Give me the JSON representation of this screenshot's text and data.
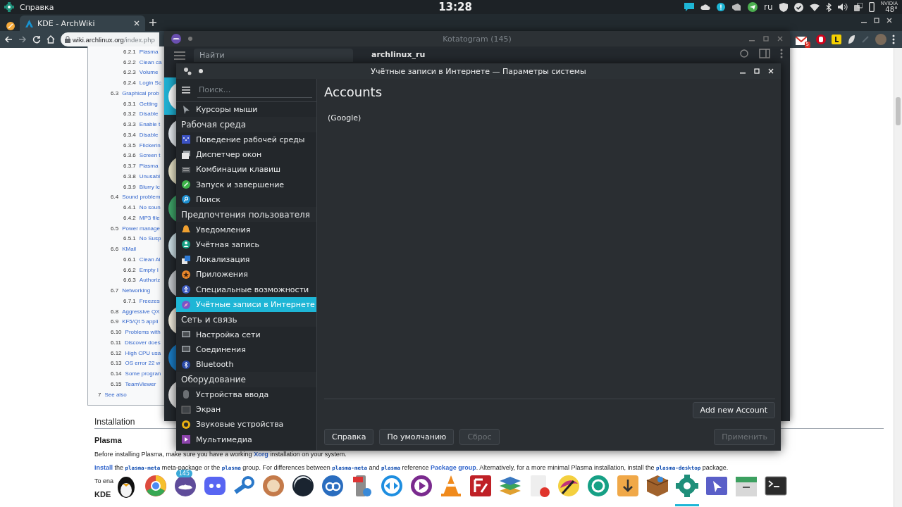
{
  "top_panel": {
    "app_title": "Справка",
    "clock": "13:28",
    "keyboard_layout": "ru",
    "gpu_label": "NVIDIA",
    "gpu_temp": "48°"
  },
  "browser": {
    "tab": {
      "title": "KDE - ArchWiki",
      "selected": true
    },
    "url_host": "wiki.archlinux.org",
    "url_path": "/index.php",
    "mail_badge": "5"
  },
  "wiki": {
    "toc": [
      {
        "children": [
          {
            "children": [
              {
                "number": "6.2.1",
                "title": "Plasma"
              },
              {
                "number": "6.2.2",
                "title": "Clean ca"
              },
              {
                "number": "6.2.3",
                "title": "Volume"
              },
              {
                "number": "6.2.4",
                "title": "Login Sc"
              }
            ]
          },
          {
            "number": "6.3",
            "title": "Graphical prob",
            "children": [
              {
                "number": "6.3.1",
                "title": "Getting"
              },
              {
                "number": "6.3.2",
                "title": "Disable"
              },
              {
                "number": "6.3.3",
                "title": "Enable t"
              },
              {
                "number": "6.3.4",
                "title": "Disable"
              },
              {
                "number": "6.3.5",
                "title": "Flickerin"
              },
              {
                "number": "6.3.6",
                "title": "Screen t"
              },
              {
                "number": "6.3.7",
                "title": "Plasma"
              },
              {
                "number": "6.3.8",
                "title": "Unusabl"
              },
              {
                "number": "6.3.9",
                "title": "Blurry ic"
              }
            ]
          },
          {
            "number": "6.4",
            "title": "Sound problem",
            "children": [
              {
                "number": "6.4.1",
                "title": "No soun"
              },
              {
                "number": "6.4.2",
                "title": "MP3 file"
              }
            ]
          },
          {
            "number": "6.5",
            "title": "Power manage",
            "children": [
              {
                "number": "6.5.1",
                "title": "No Susp"
              }
            ]
          },
          {
            "number": "6.6",
            "title": "KMail",
            "children": [
              {
                "number": "6.6.1",
                "title": "Clean Al"
              },
              {
                "number": "6.6.2",
                "title": "Empty I"
              },
              {
                "number": "6.6.3",
                "title": "Authoriz"
              }
            ]
          },
          {
            "number": "6.7",
            "title": "Networking",
            "children": [
              {
                "number": "6.7.1",
                "title": "Freezes"
              }
            ]
          },
          {
            "number": "6.8",
            "title": "Aggressive QX"
          },
          {
            "number": "6.9",
            "title": "KF5/Qt 5 appli"
          },
          {
            "number": "6.10",
            "title": "Problems with"
          },
          {
            "number": "6.11",
            "title": "Discover does"
          },
          {
            "number": "6.12",
            "title": "High CPU usa"
          },
          {
            "number": "6.13",
            "title": "OS error 22 w"
          },
          {
            "number": "6.14",
            "title": "Some progran"
          },
          {
            "number": "6.15",
            "title": "TeamViewer"
          }
        ]
      },
      {
        "number": "7",
        "title": "See also"
      }
    ],
    "heading": "Installation",
    "subheading": "Plasma",
    "paragraphs": [
      [
        {
          "kind": "text",
          "text": "Before installing Plasma, make sure you have a working "
        },
        {
          "kind": "link",
          "text": "Xorg"
        },
        {
          "kind": "text",
          "text": " installation on your system."
        }
      ],
      [
        {
          "kind": "link",
          "text": "Install"
        },
        {
          "kind": "text",
          "text": " the "
        },
        {
          "kind": "code",
          "text": "plasma-meta"
        },
        {
          "kind": "text",
          "text": " meta-package or the "
        },
        {
          "kind": "code",
          "text": "plasma"
        },
        {
          "kind": "text",
          "text": " group. For differences between "
        },
        {
          "kind": "code",
          "text": "plasma-meta"
        },
        {
          "kind": "text",
          "text": " and "
        },
        {
          "kind": "code",
          "text": "plasma"
        },
        {
          "kind": "text",
          "text": " reference "
        },
        {
          "kind": "link",
          "text": "Package group"
        },
        {
          "kind": "text",
          "text": ". Alternatively, for a more minimal Plasma installation, install the "
        },
        {
          "kind": "code",
          "text": "plasma-desktop"
        },
        {
          "kind": "text",
          "text": " package."
        }
      ]
    ],
    "partial_line": [
      "To ena"
    ],
    "next_heading": "KDE"
  },
  "kotatogram": {
    "title": "Kotatogram (145)",
    "search_placeholder": "Найти",
    "chat_title": "archlinux_ru",
    "chats": [
      {
        "selected": true
      },
      {
        "selected": false
      },
      {
        "selected": false
      },
      {
        "selected": false
      },
      {
        "selected": false
      },
      {
        "selected": false
      },
      {
        "selected": false
      },
      {
        "selected": false
      },
      {
        "selected": false
      }
    ]
  },
  "settings": {
    "title": "Учётные записи в Интернете — Параметры системы",
    "search_placeholder": "Поиск...",
    "items": [
      {
        "label": "Курсоры мыши",
        "selected": false
      }
    ],
    "sections": [
      {
        "title": "Рабочая среда",
        "items": [
          {
            "label": "Поведение рабочей среды",
            "selected": false
          },
          {
            "label": "Диспетчер окон",
            "selected": false
          },
          {
            "label": "Комбинации клавиш",
            "selected": false
          },
          {
            "label": "Запуск и завершение",
            "selected": false
          },
          {
            "label": "Поиск",
            "selected": false
          }
        ]
      },
      {
        "title": "Предпочтения пользователя",
        "items": [
          {
            "label": "Уведомления",
            "selected": false
          },
          {
            "label": "Учётная запись",
            "selected": false
          },
          {
            "label": "Локализация",
            "selected": false
          },
          {
            "label": "Приложения",
            "selected": false
          },
          {
            "label": "Специальные возможности",
            "selected": false
          },
          {
            "label": "Учётные записи в Интернете",
            "selected": true
          }
        ]
      },
      {
        "title": "Сеть и связь",
        "items": [
          {
            "label": "Настройка сети",
            "selected": false
          },
          {
            "label": "Соединения",
            "selected": false
          },
          {
            "label": "Bluetooth",
            "selected": false
          }
        ]
      },
      {
        "title": "Оборудование",
        "items": [
          {
            "label": "Устройства ввода",
            "selected": false
          },
          {
            "label": "Экран",
            "selected": false
          },
          {
            "label": "Звуковые устройства",
            "selected": false
          },
          {
            "label": "Мультимедиа",
            "selected": false
          }
        ]
      }
    ],
    "page_title": "Accounts",
    "accounts": [
      "(Google)"
    ],
    "add_button": "Add new Account",
    "buttons": [
      {
        "label": "Справка",
        "disabled": false
      },
      {
        "label": "По умолчанию",
        "disabled": false
      },
      {
        "label": "Сброс",
        "disabled": true
      }
    ],
    "apply_button": {
      "label": "Применить",
      "disabled": true
    }
  },
  "dock": {
    "items": [
      {
        "active": false
      },
      {
        "active": false
      },
      {
        "active": false,
        "badge": "145"
      },
      {
        "active": false
      },
      {
        "active": false
      },
      {
        "active": false
      },
      {
        "active": false
      },
      {
        "active": false
      },
      {
        "active": false
      },
      {
        "active": false
      },
      {
        "active": false
      },
      {
        "active": false
      },
      {
        "active": false
      },
      {
        "active": false
      },
      {
        "active": false
      },
      {
        "active": false
      },
      {
        "active": false
      },
      {
        "active": false
      },
      {
        "active": false
      },
      {
        "active": true
      },
      {
        "active": false
      },
      {
        "active": false
      },
      {
        "active": false
      }
    ]
  }
}
